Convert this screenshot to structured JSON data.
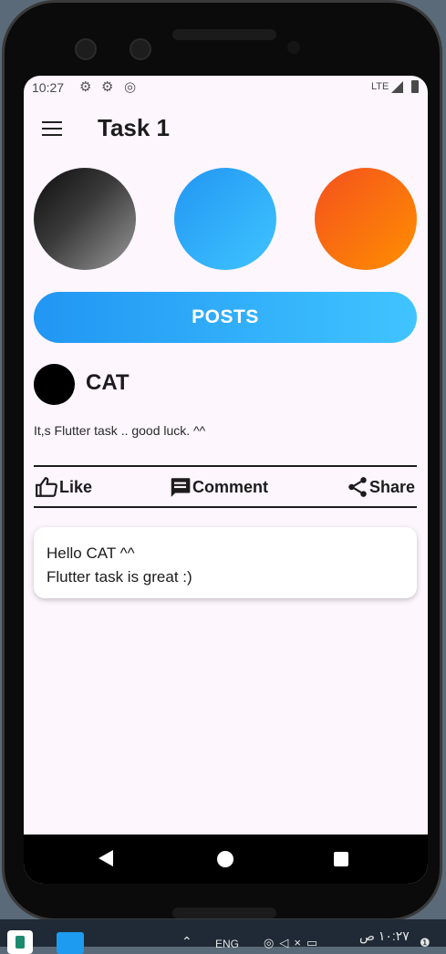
{
  "status_bar": {
    "time": "10:27",
    "network": "LTE"
  },
  "app_bar": {
    "title": "Task 1"
  },
  "circles": [
    {
      "colors": [
        "#0d0d0d",
        "#9a9a9a"
      ]
    },
    {
      "colors": [
        "#2196f3",
        "#40c4ff"
      ]
    },
    {
      "colors": [
        "#f4511e",
        "#ff8f00"
      ]
    }
  ],
  "posts_button": {
    "label": "POSTS",
    "colors": [
      "#2196f3",
      "#40c4ff"
    ]
  },
  "post": {
    "author": "CAT",
    "text": "It,s Flutter task .. good luck. ^^",
    "actions": {
      "like": "Like",
      "comment": "Comment",
      "share": "Share"
    }
  },
  "comment": {
    "lines": [
      "Hello CAT ^^",
      "Flutter task is great :)"
    ]
  },
  "taskbar": {
    "language": "ENG",
    "clock": "١٠:٢٧ ص"
  },
  "icons": {
    "menu": "menu-icon",
    "like": "thumb-up-icon",
    "comment": "comment-icon",
    "share": "share-icon",
    "nav_back": "back-icon",
    "nav_home": "home-icon",
    "nav_recent": "recent-apps-icon"
  }
}
